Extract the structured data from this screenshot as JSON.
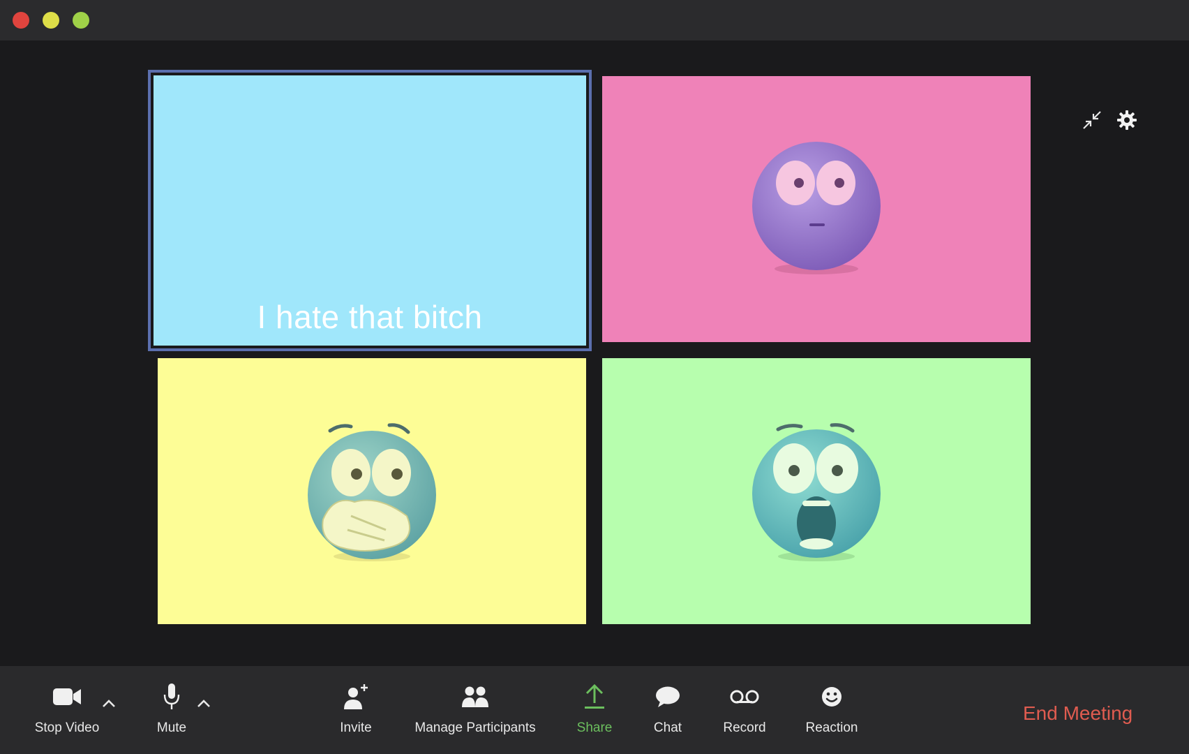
{
  "window": {
    "close_color": "#e0443e",
    "minimize_color": "#dede48",
    "maximize_color": "#9fd148"
  },
  "tiles": [
    {
      "background": "#a0e7fb",
      "caption": "I hate that bitch",
      "active": true
    },
    {
      "background": "#ef82b8",
      "emoji": "flushed-purple-emoji-icon"
    },
    {
      "background": "#fdfd96",
      "emoji": "hands-over-mouth-emoji-icon"
    },
    {
      "background": "#b7feae",
      "emoji": "shocked-open-mouth-emoji-icon"
    }
  ],
  "top_controls": {
    "exit_fullscreen_icon": "collapse-arrows-icon",
    "settings_icon": "gear-icon"
  },
  "toolbar": {
    "stop_video": "Stop Video",
    "mute": "Mute",
    "invite": "Invite",
    "manage_participants": "Manage Participants",
    "share": "Share",
    "chat": "Chat",
    "record": "Record",
    "reaction": "Reaction",
    "end_meeting": "End Meeting",
    "share_color": "#6cbf5e",
    "end_color": "#e05c50"
  }
}
